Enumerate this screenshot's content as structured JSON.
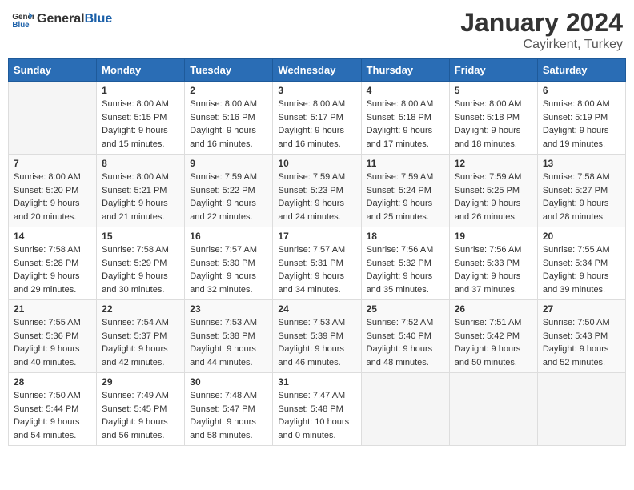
{
  "header": {
    "logo_general": "General",
    "logo_blue": "Blue",
    "month": "January 2024",
    "location": "Cayirkent, Turkey"
  },
  "days_of_week": [
    "Sunday",
    "Monday",
    "Tuesday",
    "Wednesday",
    "Thursday",
    "Friday",
    "Saturday"
  ],
  "weeks": [
    [
      {
        "day": "",
        "info": ""
      },
      {
        "day": "1",
        "info": "Sunrise: 8:00 AM\nSunset: 5:15 PM\nDaylight: 9 hours\nand 15 minutes."
      },
      {
        "day": "2",
        "info": "Sunrise: 8:00 AM\nSunset: 5:16 PM\nDaylight: 9 hours\nand 16 minutes."
      },
      {
        "day": "3",
        "info": "Sunrise: 8:00 AM\nSunset: 5:17 PM\nDaylight: 9 hours\nand 16 minutes."
      },
      {
        "day": "4",
        "info": "Sunrise: 8:00 AM\nSunset: 5:18 PM\nDaylight: 9 hours\nand 17 minutes."
      },
      {
        "day": "5",
        "info": "Sunrise: 8:00 AM\nSunset: 5:18 PM\nDaylight: 9 hours\nand 18 minutes."
      },
      {
        "day": "6",
        "info": "Sunrise: 8:00 AM\nSunset: 5:19 PM\nDaylight: 9 hours\nand 19 minutes."
      }
    ],
    [
      {
        "day": "7",
        "info": "Sunrise: 8:00 AM\nSunset: 5:20 PM\nDaylight: 9 hours\nand 20 minutes."
      },
      {
        "day": "8",
        "info": "Sunrise: 8:00 AM\nSunset: 5:21 PM\nDaylight: 9 hours\nand 21 minutes."
      },
      {
        "day": "9",
        "info": "Sunrise: 7:59 AM\nSunset: 5:22 PM\nDaylight: 9 hours\nand 22 minutes."
      },
      {
        "day": "10",
        "info": "Sunrise: 7:59 AM\nSunset: 5:23 PM\nDaylight: 9 hours\nand 24 minutes."
      },
      {
        "day": "11",
        "info": "Sunrise: 7:59 AM\nSunset: 5:24 PM\nDaylight: 9 hours\nand 25 minutes."
      },
      {
        "day": "12",
        "info": "Sunrise: 7:59 AM\nSunset: 5:25 PM\nDaylight: 9 hours\nand 26 minutes."
      },
      {
        "day": "13",
        "info": "Sunrise: 7:58 AM\nSunset: 5:27 PM\nDaylight: 9 hours\nand 28 minutes."
      }
    ],
    [
      {
        "day": "14",
        "info": "Sunrise: 7:58 AM\nSunset: 5:28 PM\nDaylight: 9 hours\nand 29 minutes."
      },
      {
        "day": "15",
        "info": "Sunrise: 7:58 AM\nSunset: 5:29 PM\nDaylight: 9 hours\nand 30 minutes."
      },
      {
        "day": "16",
        "info": "Sunrise: 7:57 AM\nSunset: 5:30 PM\nDaylight: 9 hours\nand 32 minutes."
      },
      {
        "day": "17",
        "info": "Sunrise: 7:57 AM\nSunset: 5:31 PM\nDaylight: 9 hours\nand 34 minutes."
      },
      {
        "day": "18",
        "info": "Sunrise: 7:56 AM\nSunset: 5:32 PM\nDaylight: 9 hours\nand 35 minutes."
      },
      {
        "day": "19",
        "info": "Sunrise: 7:56 AM\nSunset: 5:33 PM\nDaylight: 9 hours\nand 37 minutes."
      },
      {
        "day": "20",
        "info": "Sunrise: 7:55 AM\nSunset: 5:34 PM\nDaylight: 9 hours\nand 39 minutes."
      }
    ],
    [
      {
        "day": "21",
        "info": "Sunrise: 7:55 AM\nSunset: 5:36 PM\nDaylight: 9 hours\nand 40 minutes."
      },
      {
        "day": "22",
        "info": "Sunrise: 7:54 AM\nSunset: 5:37 PM\nDaylight: 9 hours\nand 42 minutes."
      },
      {
        "day": "23",
        "info": "Sunrise: 7:53 AM\nSunset: 5:38 PM\nDaylight: 9 hours\nand 44 minutes."
      },
      {
        "day": "24",
        "info": "Sunrise: 7:53 AM\nSunset: 5:39 PM\nDaylight: 9 hours\nand 46 minutes."
      },
      {
        "day": "25",
        "info": "Sunrise: 7:52 AM\nSunset: 5:40 PM\nDaylight: 9 hours\nand 48 minutes."
      },
      {
        "day": "26",
        "info": "Sunrise: 7:51 AM\nSunset: 5:42 PM\nDaylight: 9 hours\nand 50 minutes."
      },
      {
        "day": "27",
        "info": "Sunrise: 7:50 AM\nSunset: 5:43 PM\nDaylight: 9 hours\nand 52 minutes."
      }
    ],
    [
      {
        "day": "28",
        "info": "Sunrise: 7:50 AM\nSunset: 5:44 PM\nDaylight: 9 hours\nand 54 minutes."
      },
      {
        "day": "29",
        "info": "Sunrise: 7:49 AM\nSunset: 5:45 PM\nDaylight: 9 hours\nand 56 minutes."
      },
      {
        "day": "30",
        "info": "Sunrise: 7:48 AM\nSunset: 5:47 PM\nDaylight: 9 hours\nand 58 minutes."
      },
      {
        "day": "31",
        "info": "Sunrise: 7:47 AM\nSunset: 5:48 PM\nDaylight: 10 hours\nand 0 minutes."
      },
      {
        "day": "",
        "info": ""
      },
      {
        "day": "",
        "info": ""
      },
      {
        "day": "",
        "info": ""
      }
    ]
  ]
}
